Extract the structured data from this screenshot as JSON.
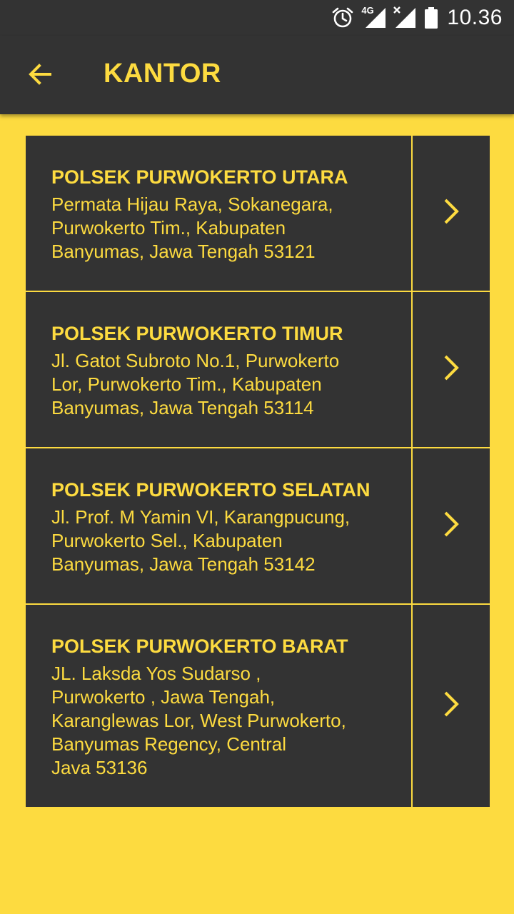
{
  "status_bar": {
    "network": "4G",
    "time": "10.36",
    "icons": [
      "alarm-icon",
      "signal-4g-icon",
      "signal-no-data-icon",
      "battery-icon"
    ]
  },
  "app_bar": {
    "title": "KANTOR",
    "back_icon": "arrow-left-icon"
  },
  "offices": [
    {
      "name": "POLSEK PURWOKERTO UTARA",
      "address": "Permata Hijau Raya, Sokanegara,\nPurwokerto Tim., Kabupaten\nBanyumas, Jawa Tengah 53121"
    },
    {
      "name": "POLSEK PURWOKERTO TIMUR",
      "address": "Jl. Gatot Subroto No.1, Purwokerto\nLor, Purwokerto Tim., Kabupaten\nBanyumas, Jawa Tengah 53114"
    },
    {
      "name": "POLSEK PURWOKERTO SELATAN",
      "address": "Jl. Prof. M Yamin VI, Karangpucung,\nPurwokerto Sel., Kabupaten\nBanyumas, Jawa Tengah 53142"
    },
    {
      "name": "POLSEK PURWOKERTO BARAT",
      "address": "JL. Laksda Yos Sudarso ,\nPurwokerto , Jawa Tengah,\nKaranglewas Lor, West Purwokerto,\nBanyumas Regency, Central\nJava 53136"
    }
  ],
  "row_action_icon": "chevron-right-icon",
  "colors": {
    "accent": "#FDDB40",
    "dark": "#333333",
    "status_text": "#FFFFFF"
  }
}
